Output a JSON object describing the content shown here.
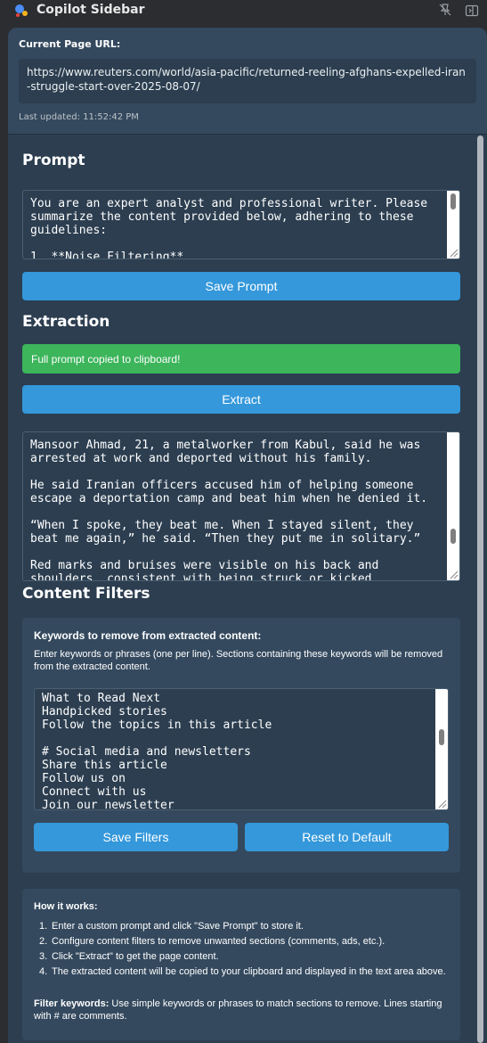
{
  "window": {
    "title": "Copilot Sidebar",
    "icons": {
      "app": "copilot-logo-icon",
      "pin": "unpin-icon",
      "hide": "hide-sidebar-icon"
    }
  },
  "header": {
    "url_label": "Current Page URL:",
    "url": "https://www.reuters.com/world/asia-pacific/returned-reeling-afghans-expelled-iran-struggle-start-over-2025-08-07/",
    "last_updated": "Last updated: 11:52:42 PM"
  },
  "prompt": {
    "heading": "Prompt",
    "text": "You are an expert analyst and professional writer. Please summarize the content provided below, adhering to these guidelines:\n\n1. **Noise Filtering**",
    "save_label": "Save Prompt"
  },
  "extraction": {
    "heading": "Extraction",
    "notice": "Full prompt copied to clipboard!",
    "extract_label": "Extract",
    "content": "Mansoor Ahmad, 21, a metalworker from Kabul, said he was arrested at work and deported without his family.\n\nHe said Iranian officers accused him of helping someone escape a deportation camp and beat him when he denied it.\n\n“When I spoke, they beat me. When I stayed silent, they beat me again,” he said. “Then they put me in solitary.”\n\nRed marks and bruises were visible on his back and shoulders, consistent with being struck or kicked."
  },
  "filters": {
    "heading": "Content Filters",
    "card_title": "Keywords to remove from extracted content:",
    "card_desc": "Enter keywords or phrases (one per line). Sections containing these keywords will be removed from the extracted content.",
    "keywords": "What to Read Next\nHandpicked stories\nFollow the topics in this article\n\n# Social media and newsletters\nShare this article\nFollow us on\nConnect with us\nJoin our newsletter",
    "save_label": "Save Filters",
    "reset_label": "Reset to Default"
  },
  "how": {
    "title": "How it works:",
    "steps": [
      "Enter a custom prompt and click \"Save Prompt\" to store it.",
      "Configure content filters to remove unwanted sections (comments, ads, etc.).",
      "Click \"Extract\" to get the page content.",
      "The extracted content will be copied to your clipboard and displayed in the text area above."
    ],
    "step_numbers": [
      "1.",
      "2.",
      "3.",
      "4."
    ],
    "foot_label": "Filter keywords:",
    "foot_text": " Use simple keywords or phrases to match sections to remove. Lines starting with # are comments."
  },
  "colors": {
    "panel": "#2c3e50",
    "card": "#34495e",
    "accent": "#3498db",
    "success": "#3cb55b"
  }
}
